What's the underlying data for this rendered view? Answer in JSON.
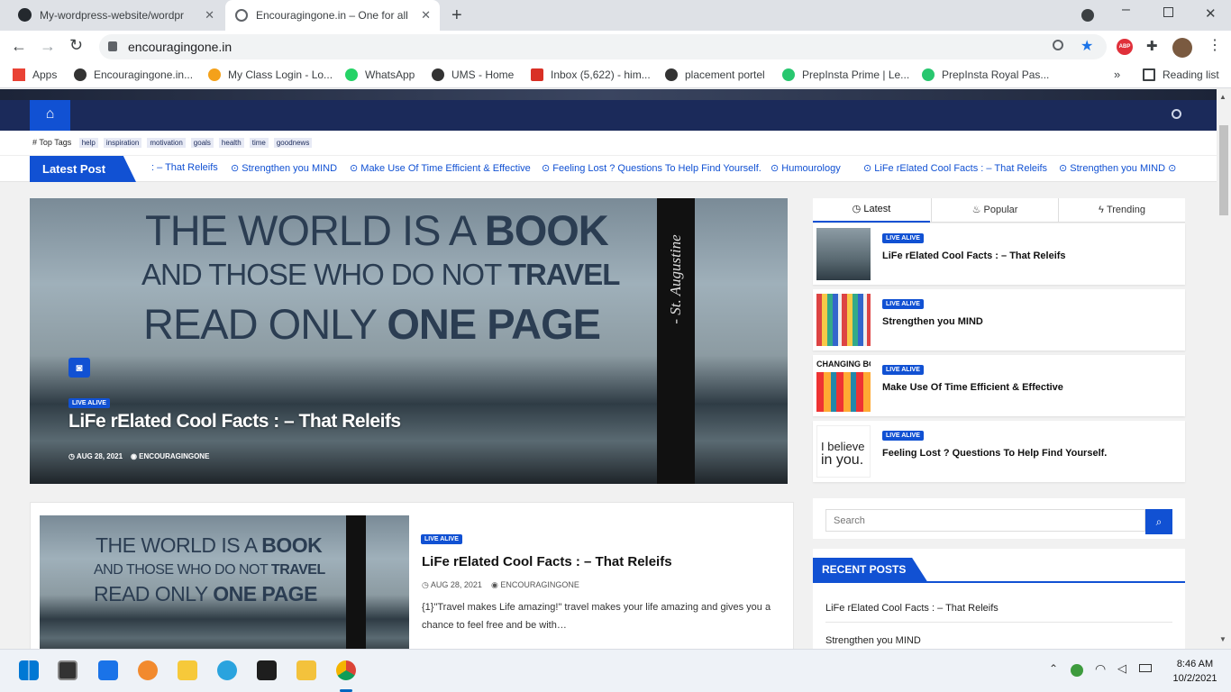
{
  "browser": {
    "tabs": [
      {
        "title": "My-wordpress-website/wordpres"
      },
      {
        "title": "Encouragingone.in – One for all !"
      }
    ],
    "url": "encouragingone.in"
  },
  "bookmarks": [
    {
      "label": "Apps",
      "color": "#e94235"
    },
    {
      "label": "Encouragingone.in...",
      "color": "#333333"
    },
    {
      "label": "My Class Login - Lo...",
      "color": "#f4a11a"
    },
    {
      "label": "WhatsApp",
      "color": "#25d366"
    },
    {
      "label": "UMS - Home",
      "color": "#333333"
    },
    {
      "label": "Inbox (5,622) - him...",
      "color": "#d93025"
    },
    {
      "label": "placement portel",
      "color": "#333333"
    },
    {
      "label": "PrepInsta Prime | Le...",
      "color": "#28c76f"
    },
    {
      "label": "PrepInsta Royal Pas...",
      "color": "#28c76f"
    }
  ],
  "reading_list": "Reading list",
  "site": {
    "top_tags_label": "Top Tags",
    "tags": [
      "help",
      "inspiration",
      "motivation",
      "goals",
      "health",
      "time",
      "goodnews"
    ],
    "latest_post_label": "Latest Post",
    "ticker": [
      ": – That Releifs",
      "Strengthen you MIND",
      "Make Use Of Time Efficient & Effective",
      "Feeling Lost ? Questions To Help Find Yourself.",
      "Humourology",
      "LiFe rElated Cool Facts : – That Releifs",
      "Strengthen you MIND"
    ],
    "hero": {
      "quote_line1a": "THE WORLD IS A ",
      "quote_line1b": "BOOK",
      "quote_line2a": "AND THOSE WHO DO NOT ",
      "quote_line2b": "TRAVEL",
      "quote_line3a": "READ ONLY ",
      "quote_line3b": "ONE PAGE",
      "side_text": "- St. Augustine",
      "badge": "LIVE ALIVE",
      "title": "LiFe rElated Cool Facts : – That Releifs",
      "date": "AUG 28, 2021",
      "author": "ENCOURAGINGONE"
    },
    "post": {
      "badge": "LIVE ALIVE",
      "title": "LiFe rElated Cool Facts : – That Releifs",
      "date": "AUG 28, 2021",
      "author": "ENCOURAGINGONE",
      "excerpt1": "{1}\"Travel makes Life amazing!\" travel makes your life amazing and gives you a",
      "excerpt2": "chance to feel free and be with…"
    },
    "sidebar": {
      "tabs": [
        "Latest",
        "Popular",
        "Trending"
      ],
      "items": [
        {
          "badge": "LIVE ALIVE",
          "title": "LiFe rElated Cool Facts : – That Releifs"
        },
        {
          "badge": "LIVE ALIVE",
          "title": "Strengthen you MIND"
        },
        {
          "badge": "LIVE ALIVE",
          "title": "Make Use Of Time Efficient & Effective",
          "thumb_text": "CHANGING BO"
        },
        {
          "badge": "LIVE ALIVE",
          "title": "Feeling Lost ? Questions To Help Find Yourself.",
          "thumb_text1": "I believe",
          "thumb_text2": "in you."
        }
      ],
      "search_placeholder": "Search",
      "recent_posts_label": "RECENT POSTS",
      "recent_posts": [
        "LiFe rElated Cool Facts : – That Releifs",
        "Strengthen you MIND"
      ]
    }
  },
  "taskbar": {
    "time": "8:46 AM",
    "date": "10/2/2021"
  }
}
